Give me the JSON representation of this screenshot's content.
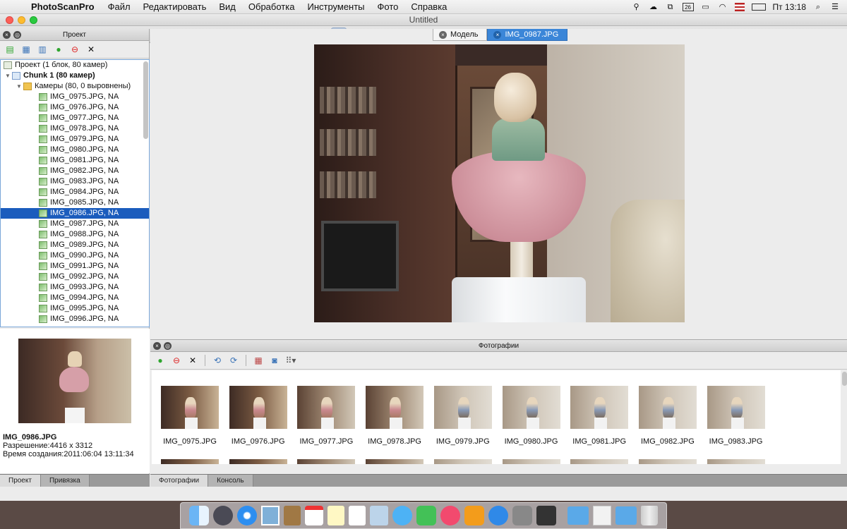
{
  "menubar": {
    "app_name": "PhotoScanPro",
    "items": [
      "Файл",
      "Редактировать",
      "Вид",
      "Обработка",
      "Инструменты",
      "Фото",
      "Справка"
    ],
    "status": {
      "calendar_day": "26",
      "clock": "Пт 13:18"
    }
  },
  "window": {
    "title": "Untitled"
  },
  "project_panel": {
    "title": "Проект",
    "tree": {
      "root": "Проект (1 блок, 80 камер)",
      "chunk": "Chunk 1 (80 камер)",
      "cameras_folder": "Камеры (80, 0 выровнены)",
      "cameras": [
        "IMG_0975.JPG, NA",
        "IMG_0976.JPG, NA",
        "IMG_0977.JPG, NA",
        "IMG_0978.JPG, NA",
        "IMG_0979.JPG, NA",
        "IMG_0980.JPG, NA",
        "IMG_0981.JPG, NA",
        "IMG_0982.JPG, NA",
        "IMG_0983.JPG, NA",
        "IMG_0984.JPG, NA",
        "IMG_0985.JPG, NA",
        "IMG_0986.JPG, NA",
        "IMG_0987.JPG, NA",
        "IMG_0988.JPG, NA",
        "IMG_0989.JPG, NA",
        "IMG_0990.JPG, NA",
        "IMG_0991.JPG, NA",
        "IMG_0992.JPG, NA",
        "IMG_0993.JPG, NA",
        "IMG_0994.JPG, NA",
        "IMG_0995.JPG, NA",
        "IMG_0996.JPG, NA"
      ],
      "selected_camera": "IMG_0986.JPG, NA"
    },
    "preview": {
      "filename": "IMG_0986.JPG",
      "resolution": "Разрешение:4416 x 3312",
      "created": "Время создания:2011:06:04 13:11:34"
    },
    "bottom_tabs": [
      "Проект",
      "Привязка"
    ]
  },
  "model_view": {
    "tabs": [
      {
        "label": "Модель",
        "active": false
      },
      {
        "label": "IMG_0987.JPG",
        "active": true
      }
    ]
  },
  "photos_panel": {
    "title": "Фотографии",
    "thumbnails": [
      {
        "label": "IMG_0975.JPG",
        "tone": "warm"
      },
      {
        "label": "IMG_0976.JPG",
        "tone": "warm"
      },
      {
        "label": "IMG_0977.JPG",
        "tone": "mixed"
      },
      {
        "label": "IMG_0978.JPG",
        "tone": "mixed"
      },
      {
        "label": "IMG_0979.JPG",
        "tone": "light"
      },
      {
        "label": "IMG_0980.JPG",
        "tone": "light"
      },
      {
        "label": "IMG_0981.JPG",
        "tone": "light"
      },
      {
        "label": "IMG_0982.JPG",
        "tone": "light"
      },
      {
        "label": "IMG_0983.JPG",
        "tone": "light"
      }
    ],
    "bottom_tabs": [
      "Фотографии",
      "Консоль"
    ]
  }
}
